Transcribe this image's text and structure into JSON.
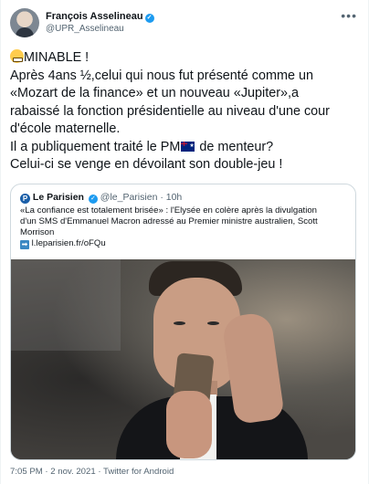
{
  "tweet": {
    "author_name": "François Asselineau",
    "author_handle": "@UPR_Asselineau",
    "more_icon": "ellipsis-icon",
    "body": {
      "line1": "MINABLE !",
      "line2": "Après 4ans ½,celui qui nous fut présenté comme un",
      "line3": "«Mozart de la finance» et un nouveau «Jupiter»,a",
      "line4": "rabaissé la fonction présidentielle au niveau d'une cour",
      "line5": "d'école maternelle.",
      "line6_before": "Il a publiquement traité le PM",
      "line6_after": " de menteur?",
      "line7": "Celui-ci se venge en dévoilant son double-jeu !"
    },
    "quoted": {
      "source_name": "Le Parisien",
      "source_handle": "@le_Parisien",
      "time": "10h",
      "text_line1": "«La confiance est totalement brisée» : l'Elysée en colère après la divulgation",
      "text_line2": "d'un SMS d'Emmanuel Macron adressé au Premier ministre australien, Scott",
      "text_line3": "Morrison",
      "link": "l.leparisien.fr/oFQu"
    },
    "meta": "7:05 PM · 2 nov. 2021 · Twitter for Android"
  },
  "colors": {
    "accent": "#1d9bf0",
    "muted": "#536471",
    "border": "#cfd9de"
  }
}
